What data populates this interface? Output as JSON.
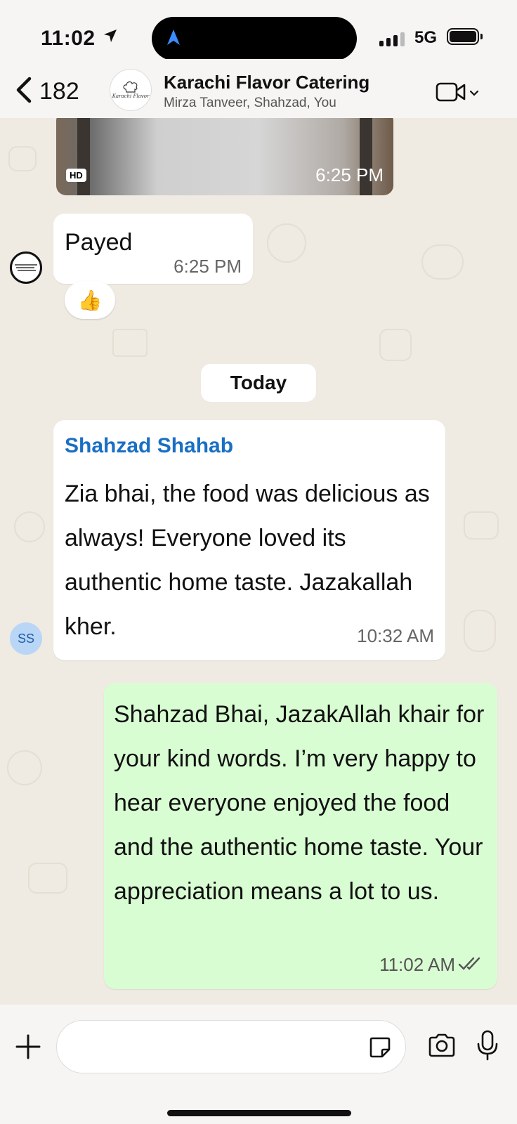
{
  "status_bar": {
    "time": "11:02",
    "network": "5G",
    "icons": [
      "location-arrow-icon",
      "signal-icon",
      "battery-icon"
    ]
  },
  "header": {
    "back_count": "182",
    "group_title": "Karachi Flavor Catering",
    "group_subtitle": "Mirza Tanveer, Shahzad, You",
    "avatar_logo_text": "Karachi Flavor",
    "icons": [
      "back-chevron-icon",
      "video-call-icon",
      "chevron-down-icon"
    ]
  },
  "messages": {
    "image_message": {
      "badge": "HD",
      "time": "6:25 PM"
    },
    "payed_message": {
      "text": "Payed",
      "time": "6:25 PM",
      "reaction": "👍"
    },
    "date_separator": "Today",
    "incoming_message": {
      "sender": "Shahzad Shahab",
      "sender_initials": "SS",
      "text": "Zia bhai, the food was delicious as always! Everyone loved its authentic home taste. Jazakallah kher.",
      "time": "10:32 AM"
    },
    "outgoing_message": {
      "text": "Shahzad Bhai, JazakAllah khair for your kind words. I’m very happy to hear everyone enjoyed the food and the authentic home taste. Your appreciation means a lot to us.",
      "time": "11:02 AM",
      "status": "read"
    }
  },
  "input_bar": {
    "placeholder": "",
    "icons": [
      "plus-icon",
      "sticker-icon",
      "camera-icon",
      "microphone-icon"
    ]
  },
  "colors": {
    "chat_background": "#efeae2",
    "outgoing_bubble": "#d9fdd3",
    "incoming_bubble": "#ffffff",
    "sender_name": "#1a6fc4",
    "status_bar_bg": "#f6f5f3"
  }
}
